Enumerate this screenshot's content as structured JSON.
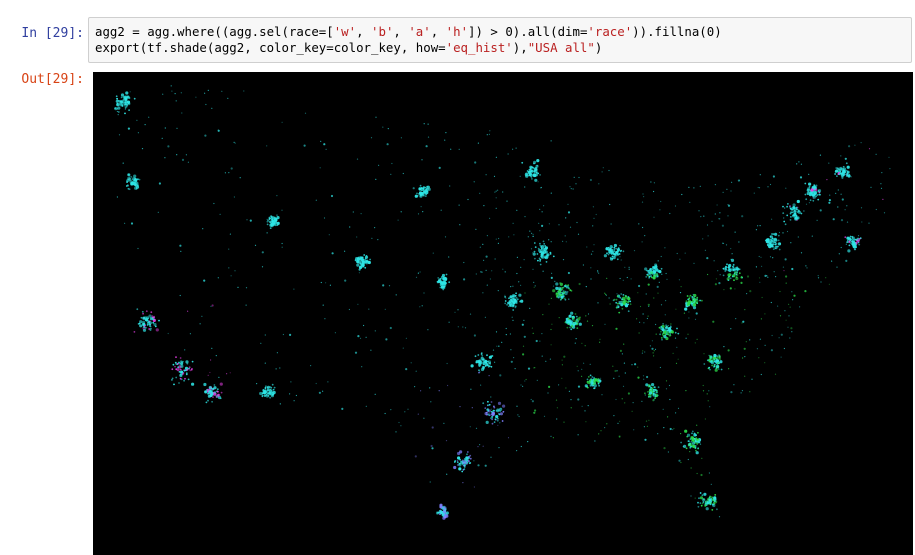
{
  "cell": {
    "input_prompt": "In [29]:",
    "output_prompt": "Out[29]:",
    "code_line_1": {
      "a": "agg2 = agg.where((agg.sel(race=[",
      "s1": "'w'",
      "c1": ", ",
      "s2": "'b'",
      "c2": ", ",
      "s3": "'a'",
      "c3": ", ",
      "s4": "'h'",
      "b": "]) > 0).all(dim=",
      "s5": "'race'",
      "c": ")).fillna(0)"
    },
    "code_line_2": {
      "a": "export(tf.shade(agg2, color_key=color_key, how=",
      "s1": "'eq_hist'",
      "b": "),",
      "s2": "\"USA all\"",
      "c": ")"
    }
  },
  "output": {
    "image_kind": "us-population-density-map",
    "background_color": "#000000",
    "colors": {
      "white": "#2ee6e6",
      "black": "#2bdc4a",
      "asian": "#e63ee6",
      "hispanic": "#7f7fff"
    }
  }
}
